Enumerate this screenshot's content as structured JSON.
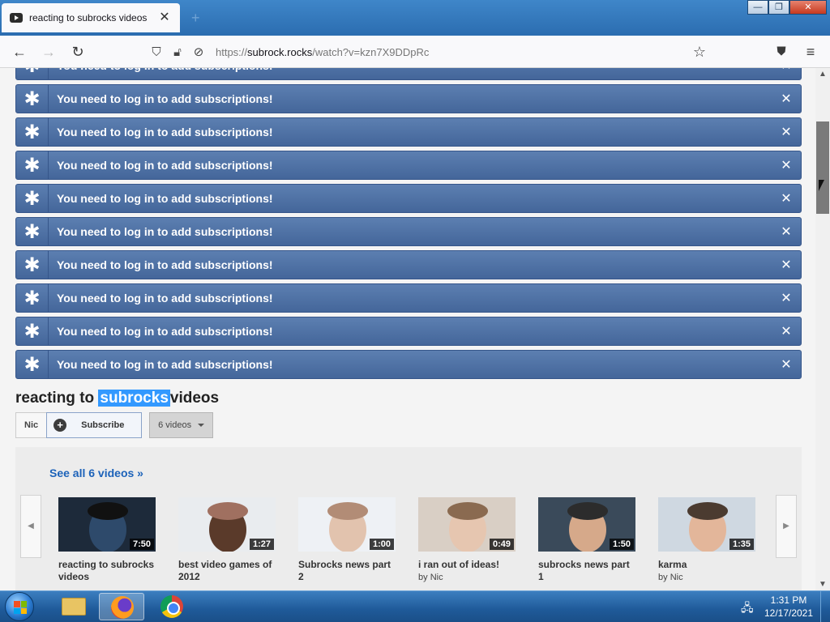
{
  "browser": {
    "tab_title": "reacting to subrocks videos",
    "tab_close": "✕",
    "new_tab": "+",
    "url_scheme": "https://",
    "url_host": "subrock.rocks",
    "url_path": "/watch?v=kzn7X9DDpRc",
    "window_controls": {
      "minimize": "—",
      "maximize": "❐",
      "close": "✕"
    }
  },
  "alerts": {
    "message": "You need to log in to add subscriptions!",
    "icon": "✱",
    "close": "✕",
    "items": [
      {
        "text": "You need to log in to add subscriptions!"
      },
      {
        "text": "You need to log in to add subscriptions!"
      },
      {
        "text": "You need to log in to add subscriptions!"
      },
      {
        "text": "You need to log in to add subscriptions!"
      },
      {
        "text": "You need to log in to add subscriptions!"
      },
      {
        "text": "You need to log in to add subscriptions!"
      },
      {
        "text": "You need to log in to add subscriptions!"
      },
      {
        "text": "You need to log in to add subscriptions!"
      },
      {
        "text": "You need to log in to add subscriptions!"
      },
      {
        "text": "You need to log in to add subscriptions!"
      }
    ]
  },
  "video": {
    "title_before": "reacting to",
    "title_highlight": "subrocks",
    "title_after": "videos"
  },
  "channel": {
    "name": "Nic",
    "subscribe_label": "Subscribe",
    "videos_label": "6 videos"
  },
  "shelf": {
    "see_all": "See all 6 videos »",
    "prev": "◀",
    "next": "▶",
    "videos": [
      {
        "title": "reacting to subrocks videos",
        "duration": "7:50",
        "by": "",
        "author": ""
      },
      {
        "title": "best video games of 2012",
        "duration": "1:27",
        "by": "",
        "author": ""
      },
      {
        "title": "Subrocks news part 2",
        "duration": "1:00",
        "by": "",
        "author": ""
      },
      {
        "title": "i ran out of ideas!",
        "duration": "0:49",
        "by": "by",
        "author": "Nic"
      },
      {
        "title": "subrocks news part 1",
        "duration": "1:50",
        "by": "",
        "author": ""
      },
      {
        "title": "karma",
        "duration": "1:35",
        "by": "by",
        "author": "Nic"
      }
    ]
  },
  "taskbar": {
    "time": "1:31 PM",
    "date": "12/17/2021"
  },
  "colors": {
    "alert_bg": "#4f72a6",
    "link": "#1c62b9",
    "highlight": "#3399ff"
  }
}
